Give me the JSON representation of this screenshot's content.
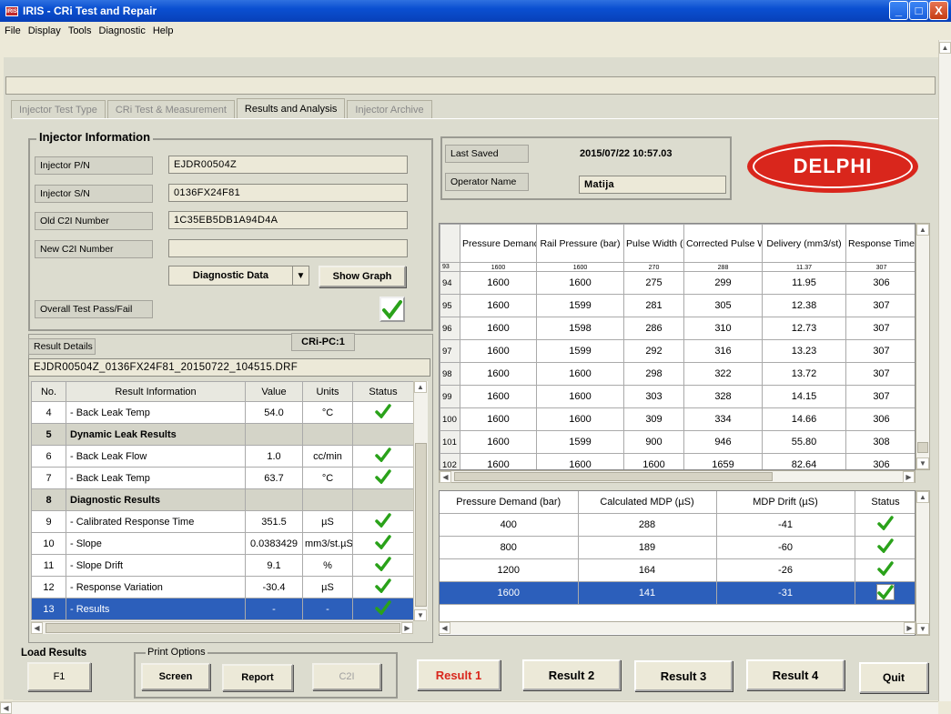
{
  "window": {
    "title": "IRIS - CRi Test and Repair",
    "logo": "IRIS",
    "min": "_",
    "max": "□",
    "close": "X"
  },
  "menu": [
    "File",
    "Display",
    "Tools",
    "Diagnostic",
    "Help"
  ],
  "tabs": [
    "Injector Test Type",
    "CRi Test & Measurement",
    "Results and Analysis",
    "Injector Archive"
  ],
  "injector_info": {
    "title": "Injector Information",
    "pn_label": "Injector P/N",
    "pn_value": "EJDR00504Z",
    "sn_label": "Injector S/N",
    "sn_value": "0136FX24F81",
    "old_c2i_label": "Old C2I Number",
    "old_c2i_value": "1C35EB5DB1A94D4A",
    "new_c2i_label": "New C2I Number",
    "new_c2i_value": "",
    "dropdown": "Diagnostic Data",
    "show_graph": "Show Graph",
    "overall_label": "Overall Test Pass/Fail"
  },
  "result_details": {
    "label": "Result Details",
    "crpc": "CRi-PC:1",
    "filename": "EJDR00504Z_0136FX24F81_20150722_104515.DRF",
    "columns": [
      "No.",
      "Result Information",
      "Value",
      "Units",
      "Status"
    ],
    "rows": [
      {
        "no": "4",
        "info": "- Back Leak Temp",
        "value": "54.0",
        "units": "°C",
        "status": "pass",
        "type": "data"
      },
      {
        "no": "5",
        "info": "Dynamic Leak Results",
        "value": "",
        "units": "",
        "status": "",
        "type": "header"
      },
      {
        "no": "6",
        "info": "- Back Leak Flow",
        "value": "1.0",
        "units": "cc/min",
        "status": "pass",
        "type": "data"
      },
      {
        "no": "7",
        "info": "- Back Leak Temp",
        "value": "63.7",
        "units": "°C",
        "status": "pass",
        "type": "data"
      },
      {
        "no": "8",
        "info": "Diagnostic Results",
        "value": "",
        "units": "",
        "status": "",
        "type": "header"
      },
      {
        "no": "9",
        "info": "- Calibrated Response Time",
        "value": "351.5",
        "units": "µS",
        "status": "pass",
        "type": "data"
      },
      {
        "no": "10",
        "info": "- Slope",
        "value": "0.0383429",
        "units": "mm3/st.µS",
        "status": "pass",
        "type": "data"
      },
      {
        "no": "11",
        "info": "- Slope Drift",
        "value": "9.1",
        "units": "%",
        "status": "pass",
        "type": "data"
      },
      {
        "no": "12",
        "info": "- Response Variation",
        "value": "-30.4",
        "units": "µS",
        "status": "pass",
        "type": "data"
      },
      {
        "no": "13",
        "info": "- Results",
        "value": "-",
        "units": "-",
        "status": "pass",
        "type": "selected"
      }
    ]
  },
  "save_info": {
    "last_saved_label": "Last Saved",
    "last_saved_value": "2015/07/22 10:57.03",
    "operator_label": "Operator Name",
    "operator_value": "Matija"
  },
  "brand": {
    "logo_text": "DELPHI",
    "color": "#d9261c"
  },
  "test_table": {
    "columns": [
      "Pressure Demand (bar)",
      "Rail Pressure (bar)",
      "Pulse Width (µS)",
      "Corrected Pulse Width",
      "Delivery (mm3/st)",
      "Response Time (µS)"
    ],
    "partial_row": {
      "num": "93",
      "cells": [
        "1600",
        "1600",
        "270",
        "288",
        "11.37",
        "307"
      ]
    },
    "rows": [
      {
        "num": "94",
        "cells": [
          "1600",
          "1600",
          "275",
          "299",
          "11.95",
          "306"
        ]
      },
      {
        "num": "95",
        "cells": [
          "1600",
          "1599",
          "281",
          "305",
          "12.38",
          "307"
        ]
      },
      {
        "num": "96",
        "cells": [
          "1600",
          "1598",
          "286",
          "310",
          "12.73",
          "307"
        ]
      },
      {
        "num": "97",
        "cells": [
          "1600",
          "1599",
          "292",
          "316",
          "13.23",
          "307"
        ]
      },
      {
        "num": "98",
        "cells": [
          "1600",
          "1600",
          "298",
          "322",
          "13.72",
          "307"
        ]
      },
      {
        "num": "99",
        "cells": [
          "1600",
          "1600",
          "303",
          "328",
          "14.15",
          "307"
        ]
      },
      {
        "num": "100",
        "cells": [
          "1600",
          "1600",
          "309",
          "334",
          "14.66",
          "306"
        ]
      },
      {
        "num": "101",
        "cells": [
          "1600",
          "1599",
          "900",
          "946",
          "55.80",
          "308"
        ]
      },
      {
        "num": "102",
        "cells": [
          "1600",
          "1600",
          "1600",
          "1659",
          "82.64",
          "306"
        ]
      }
    ]
  },
  "mdp_table": {
    "columns": [
      "Pressure Demand (bar)",
      "Calculated MDP (µS)",
      "MDP Drift (µS)",
      "Status"
    ],
    "rows": [
      {
        "cells": [
          "400",
          "288",
          "-41"
        ],
        "status": "pass",
        "selected": false
      },
      {
        "cells": [
          "800",
          "189",
          "-60"
        ],
        "status": "pass",
        "selected": false
      },
      {
        "cells": [
          "1200",
          "164",
          "-26"
        ],
        "status": "pass",
        "selected": false
      },
      {
        "cells": [
          "1600",
          "141",
          "-31"
        ],
        "status": "pass",
        "selected": true
      }
    ]
  },
  "bottom": {
    "load_results": "Load Results",
    "f1": "F1",
    "print_options": "Print Options",
    "screen": "Screen",
    "report": "Report",
    "c2i": "C2I",
    "result1": "Result 1",
    "result2": "Result 2",
    "result3": "Result 3",
    "result4": "Result 4",
    "quit": "Quit"
  },
  "colors": {
    "check": "#2aa21a",
    "selection": "#2c5fbb",
    "result1": "#d9261c"
  }
}
